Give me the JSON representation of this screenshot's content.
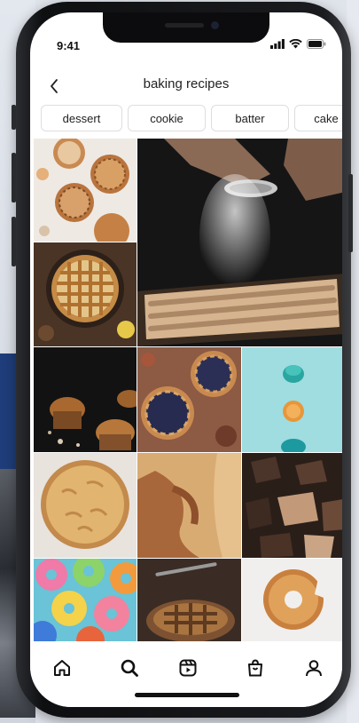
{
  "status_bar": {
    "time": "9:41",
    "icons": [
      "signal-icon",
      "wifi-icon",
      "battery-icon"
    ]
  },
  "header": {
    "back_icon": "chevron-left-icon",
    "title": "baking recipes"
  },
  "chips": [
    {
      "label": "dessert"
    },
    {
      "label": "cookie"
    },
    {
      "label": "batter"
    },
    {
      "label": "cake"
    }
  ],
  "grid": [
    {
      "subject": "lattice tartlets"
    },
    {
      "subject": "sifting flour over apple tart"
    },
    {
      "subject": "lattice pie"
    },
    {
      "subject": "muffins on dark table"
    },
    {
      "subject": "blueberry lattice tarts"
    },
    {
      "subject": "macarons on blue"
    },
    {
      "subject": "apple pie"
    },
    {
      "subject": "crumble dessert"
    },
    {
      "subject": "chocolate chunks"
    },
    {
      "subject": "colorful donuts"
    },
    {
      "subject": "pie close-up"
    },
    {
      "subject": "glazed donut"
    }
  ],
  "tab_bar": [
    {
      "icon": "home-icon"
    },
    {
      "icon": "search-icon"
    },
    {
      "icon": "reels-icon"
    },
    {
      "icon": "shop-icon"
    },
    {
      "icon": "profile-icon"
    }
  ],
  "colors": {
    "accent": "#111111",
    "chip_border": "#dedede",
    "screen_bg": "#ffffff"
  }
}
